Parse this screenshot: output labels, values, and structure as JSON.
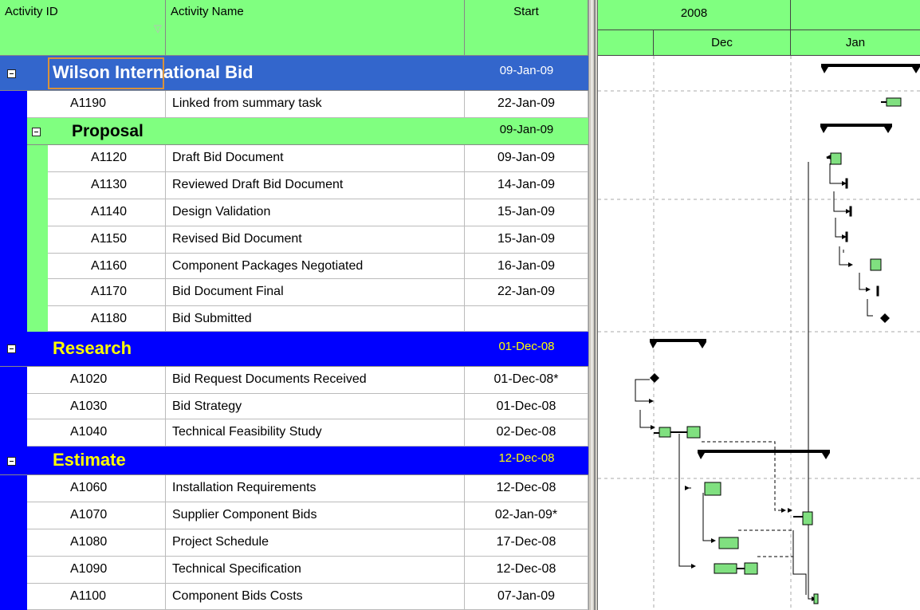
{
  "columns": {
    "activity_id": "Activity ID",
    "activity_name": "Activity Name",
    "start": "Start"
  },
  "timeline": {
    "year": "2008",
    "months": [
      "Dec",
      "Jan"
    ]
  },
  "groups": {
    "wilson": {
      "name": "Wilson International Bid",
      "start": "09-Jan-09"
    },
    "proposal": {
      "name": "Proposal",
      "start": "09-Jan-09"
    },
    "research": {
      "name": "Research",
      "start": "01-Dec-08"
    },
    "estimate": {
      "name": "Estimate",
      "start": "12-Dec-08"
    }
  },
  "activities": {
    "a1190": {
      "id": "A1190",
      "name": "Linked from summary task",
      "start": "22-Jan-09"
    },
    "a1120": {
      "id": "A1120",
      "name": "Draft Bid Document",
      "start": "09-Jan-09"
    },
    "a1130": {
      "id": "A1130",
      "name": "Reviewed Draft Bid Document",
      "start": "14-Jan-09"
    },
    "a1140": {
      "id": "A1140",
      "name": "Design Validation",
      "start": "15-Jan-09"
    },
    "a1150": {
      "id": "A1150",
      "name": "Revised Bid Document",
      "start": "15-Jan-09"
    },
    "a1160": {
      "id": "A1160",
      "name": "Component Packages Negotiated",
      "start": "16-Jan-09"
    },
    "a1170": {
      "id": "A1170",
      "name": "Bid Document Final",
      "start": "22-Jan-09"
    },
    "a1180": {
      "id": "A1180",
      "name": "Bid Submitted",
      "start": ""
    },
    "a1020": {
      "id": "A1020",
      "name": "Bid Request Documents Received",
      "start": "01-Dec-08*"
    },
    "a1030": {
      "id": "A1030",
      "name": "Bid Strategy",
      "start": "01-Dec-08"
    },
    "a1040": {
      "id": "A1040",
      "name": "Technical Feasibility Study",
      "start": "02-Dec-08"
    },
    "a1060": {
      "id": "A1060",
      "name": "Installation Requirements",
      "start": "12-Dec-08"
    },
    "a1070": {
      "id": "A1070",
      "name": "Supplier Component Bids",
      "start": "02-Jan-09*"
    },
    "a1080": {
      "id": "A1080",
      "name": "Project Schedule",
      "start": "17-Dec-08"
    },
    "a1090": {
      "id": "A1090",
      "name": "Technical Specification",
      "start": "12-Dec-08"
    },
    "a1100": {
      "id": "A1100",
      "name": "Component Bids Costs",
      "start": "07-Jan-09"
    }
  },
  "colors": {
    "header_green": "#80ff80",
    "group_blue": "#0000ff",
    "wilson_blue": "#3366cc",
    "group_text_yellow": "#ffff00",
    "bar_fill": "#80e080"
  }
}
